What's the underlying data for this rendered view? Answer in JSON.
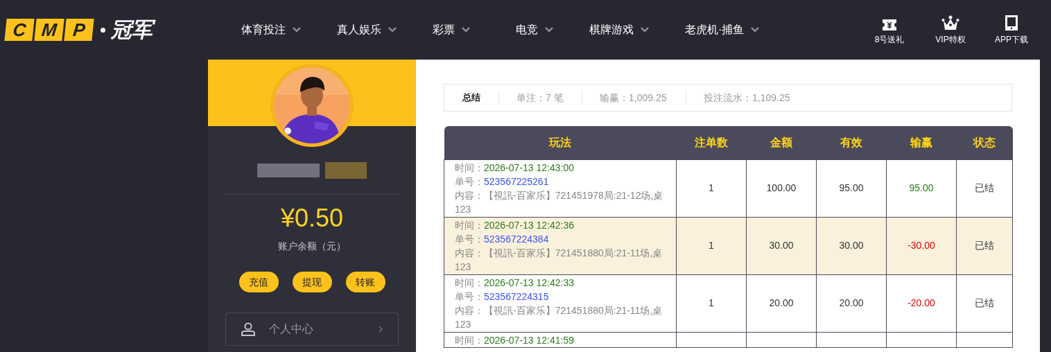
{
  "logo": {
    "letters": [
      "C",
      "M",
      "P"
    ],
    "name": "冠军"
  },
  "nav": [
    {
      "label": "体育投注"
    },
    {
      "label": "真人娱乐"
    },
    {
      "label": "彩票"
    },
    {
      "label": "电竞"
    },
    {
      "label": "棋牌游戏"
    },
    {
      "label": "老虎机·捕鱼"
    }
  ],
  "quick_links": [
    {
      "kind": "ticket",
      "label": "8号送礼"
    },
    {
      "kind": "crown",
      "label": "VIP特权"
    },
    {
      "kind": "phone",
      "label": "APP下载"
    }
  ],
  "sidebar": {
    "avatar": {
      "kind": "picture"
    },
    "balance": "¥0.50",
    "balance_label": "账户余额（元）",
    "actions": [
      "充值",
      "提现",
      "转账"
    ],
    "menu": [
      {
        "label": "个人中心"
      }
    ]
  },
  "summary": {
    "title": "总结",
    "items": [
      "单注：7 笔",
      "输赢：1,009.25",
      "投注流水：1,109.25"
    ]
  },
  "table": {
    "columns": [
      "玩法",
      "注单数",
      "金额",
      "有效",
      "输赢",
      "状态"
    ],
    "rows": [
      {
        "time_label": "时间：",
        "time": "2026-07-13 12:43:00",
        "id_label": "单号：",
        "id": "523567225261",
        "content_label": "内容：",
        "content": "【視訊-百家乐】721451978局:21-12场,桌123",
        "count": "1",
        "amount": "100.00",
        "valid": "95.00",
        "color": "#2a7a1a",
        "winloss": "95.00",
        "status": "已结",
        "highlighted": false
      },
      {
        "time_label": "时间：",
        "time": "2026-07-13 12:42:36",
        "id_label": "单号：",
        "id": "523567224384",
        "content_label": "内容：",
        "content": "【視訊-百家乐】721451880局:21-11场,桌123",
        "count": "1",
        "amount": "30.00",
        "valid": "30.00",
        "color": "#e00000",
        "winloss": "-30.00",
        "status": "已结",
        "highlighted": true
      },
      {
        "time_label": "时间：",
        "time": "2026-07-13 12:42:33",
        "id_label": "单号：",
        "id": "523567224315",
        "content_label": "内容：",
        "content": "【視訊-百家乐】721451880局:21-11场,桌123",
        "count": "1",
        "amount": "20.00",
        "valid": "20.00",
        "color": "#e00000",
        "winloss": "-20.00",
        "status": "已结",
        "highlighted": false
      },
      {
        "time_label": "时间：",
        "time": "2026-07-13 12:41:59",
        "highlighted": false
      }
    ]
  }
}
